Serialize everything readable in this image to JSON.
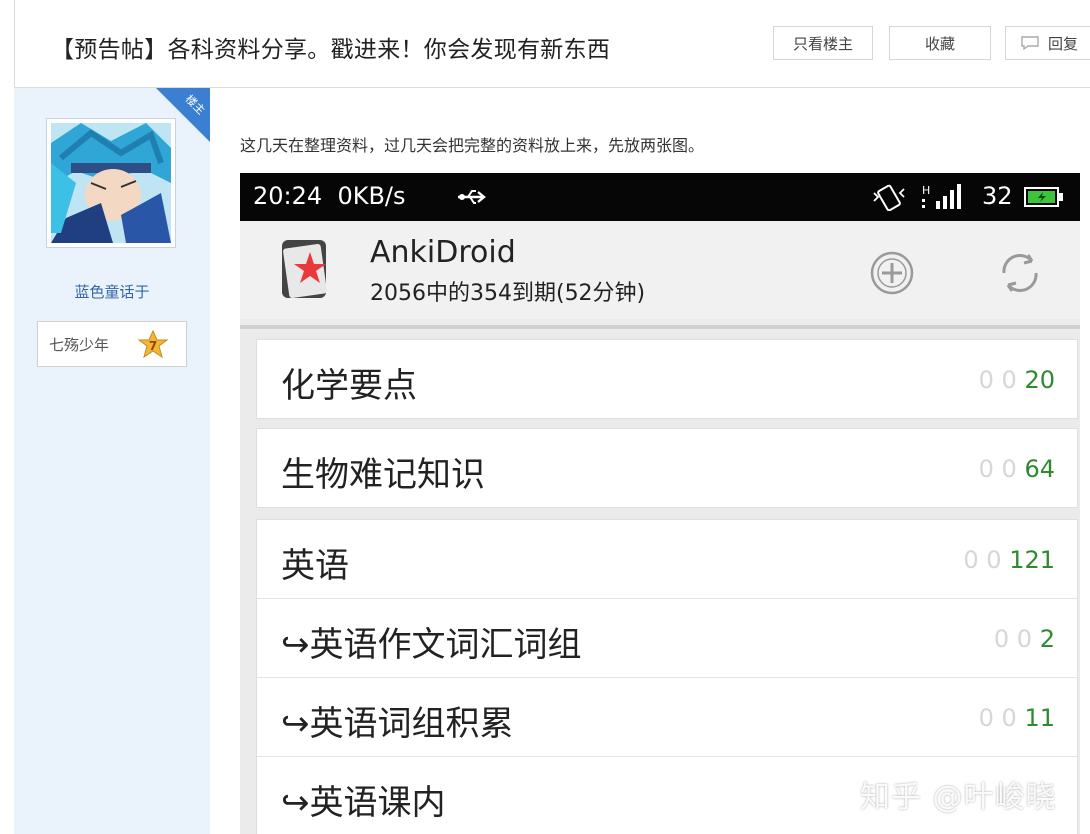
{
  "post": {
    "title": "【预告帖】各科资料分享。戳进来！你会发现有新东西",
    "buttons": {
      "only_op": "只看楼主",
      "favorite": "收藏",
      "reply": "回复"
    },
    "corner_badge": "楼主",
    "author": {
      "name": "蓝色童话于",
      "rank": "七殇少年",
      "level": "7"
    },
    "content_text": "这几天在整理资料，过几天会把完整的资料放上来，先放两张图。"
  },
  "phone": {
    "status": {
      "time": "20:24",
      "speed": "0KB/s",
      "network": "H",
      "battery": "32"
    },
    "app": {
      "name": "AnkiDroid",
      "subtitle": "2056中的354到期(52分钟)"
    },
    "decks": [
      {
        "name": "化学要点",
        "new": "0",
        "learn": "0",
        "due": "20"
      },
      {
        "name": "生物难记知识",
        "new": "0",
        "learn": "0",
        "due": "64"
      },
      {
        "name": "英语",
        "new": "0",
        "learn": "0",
        "due": "121"
      },
      {
        "name": "↪英语作文词汇词组",
        "new": "0",
        "learn": "0",
        "due": "2"
      },
      {
        "name": "↪英语词组积累",
        "new": "0",
        "learn": "0",
        "due": "11"
      },
      {
        "name": "↪英语课内",
        "new": "",
        "learn": "",
        "due": ""
      }
    ],
    "colors": {
      "due": "#2e8a2e",
      "zero": "#d6d6d6"
    }
  },
  "watermark": "知乎 @叶峻晓"
}
